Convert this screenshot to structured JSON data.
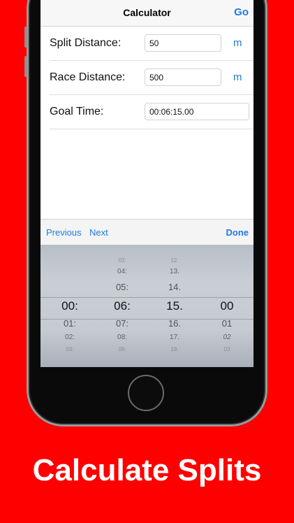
{
  "navbar": {
    "title": "Calculator",
    "go_label": "Go"
  },
  "form": {
    "rows": [
      {
        "label": "Split Distance:",
        "value": "50",
        "unit": "m"
      },
      {
        "label": "Race Distance:",
        "value": "500",
        "unit": "m"
      },
      {
        "label": "Goal Time:",
        "value": "00:06:15.00"
      }
    ]
  },
  "toolbar": {
    "previous": "Previous",
    "next": "Next",
    "done": "Done"
  },
  "picker": {
    "columns": [
      {
        "items": [
          "",
          "",
          "00:",
          "01:",
          "02:",
          "03:"
        ]
      },
      {
        "items": [
          "03:",
          "04:",
          "05:",
          "06:",
          "07:",
          "08:",
          "09:"
        ]
      },
      {
        "items": [
          "12.",
          "13.",
          "14.",
          "15.",
          "16.",
          "17.",
          "18."
        ]
      },
      {
        "items": [
          "",
          "",
          "",
          "00",
          "01",
          "02",
          "03"
        ]
      }
    ],
    "selected": [
      "00:",
      "06:",
      "15.",
      "00"
    ]
  },
  "caption": "Calculate Splits"
}
